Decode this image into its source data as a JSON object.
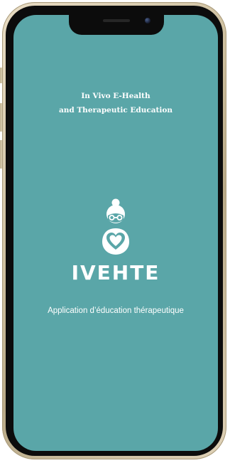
{
  "splash": {
    "headline_line1": "In Vivo E-Health",
    "headline_line2": "and Therapeutic Education",
    "brand_name": "IVEHTE",
    "subtitle": "Application d’éducation thérapeutique"
  },
  "logo_icon": "grandmother-with-heart-icon",
  "colors": {
    "screen_background": "#5aa6a8",
    "text": "#ffffff",
    "phone_frame": "#cdbf9f"
  }
}
